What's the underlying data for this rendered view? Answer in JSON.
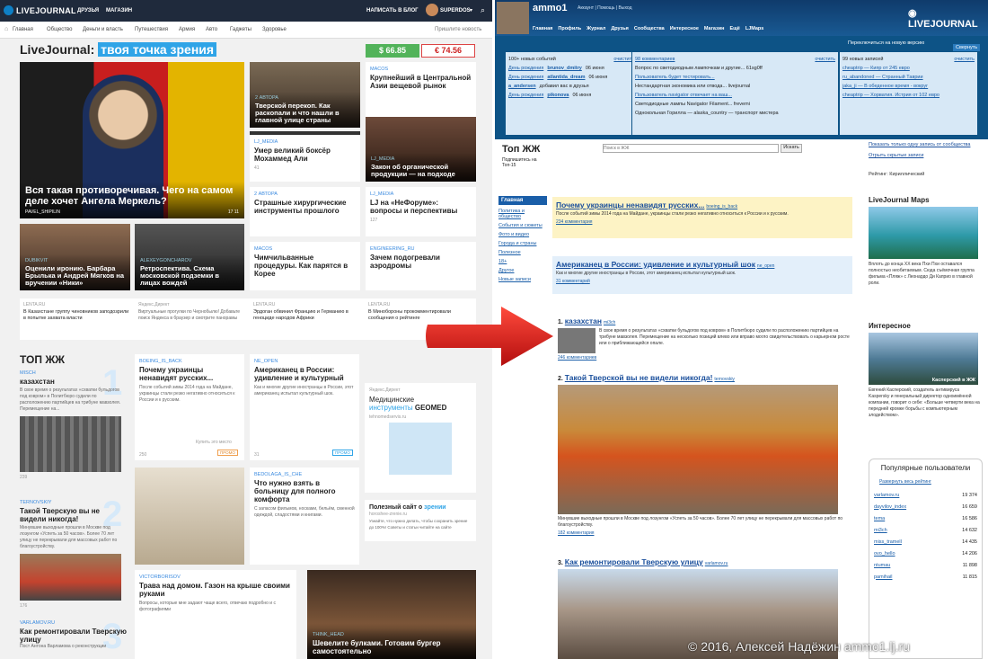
{
  "left": {
    "topbar": {
      "logo": "LIVEJOURNAL",
      "nav": [
        "ДРУЗЬЯ",
        "МАГАЗИН"
      ],
      "write": "НАПИСАТЬ В БЛОГ",
      "user": "SUPERDOS"
    },
    "cats": [
      "Главная",
      "Общество",
      "Деньги и власть",
      "Путешествия",
      "Армия",
      "Авто",
      "Гаджеты",
      "Здоровье"
    ],
    "suggest": "Пришлите новость",
    "headline_a": "LiveJournal:",
    "headline_b": "твоя точка зрения",
    "usd": "$ 66.85",
    "eur": "€ 74.56",
    "hero": {
      "title": "Вся такая противоречивая. Чего на самом деле хочет Ангела Меркель?",
      "author": "PAVEL_SHIPILIN",
      "m1": "17",
      "m2": "11"
    },
    "tiles": [
      {
        "a": "2 АВТОРА",
        "t": "Тверской перекоп. Как раскопали и что нашли в главной улице страны"
      },
      {
        "a": "MACOS",
        "t": "Крупнейший в Центральной Азии вещевой рынок"
      },
      {
        "a": "LJ_MEDIA",
        "t": "Умер великий боксёр Мохаммед Али",
        "m": "41"
      },
      {
        "a": "LJ_MEDIA",
        "t": "Закон об органической продукции — на подходе"
      },
      {
        "a": "2 АВТОРА",
        "t": "Страшные хирургические инструменты прошлого"
      },
      {
        "a": "LJ_MEDIA",
        "t": "LJ на «НеФоруме»: вопросы и перспективы",
        "m": "127"
      },
      {
        "a": "DUBIKVIT",
        "t": "Оценили иронию. Барбара Брылька и Андрей Мягков на вручении «Ники»"
      },
      {
        "a": "ALEXEYGONCHAROV",
        "t": "Ретроспектива. Схема московской подземки в лицах вождей"
      },
      {
        "a": "MACOS",
        "t": "Чимчильванные процедуры. Как парятся в Корее"
      },
      {
        "a": "ENGINEERING_RU",
        "t": "Зачем подогревали аэродромы"
      }
    ],
    "news": [
      {
        "s": "LENTA.RU",
        "t": "В Казахстане группу чиновников заподозрили в попытке захвата власти"
      },
      {
        "s": "Яндекс.Директ",
        "t": "Виртуальные прогулки по Чернобылю! Добавьте поиск Яндекса в браузер и смотрите панорамы"
      },
      {
        "s": "LENTA.RU",
        "t": "Эрдоган обвинил Францию и Германию в геноциде народов Африки"
      },
      {
        "s": "LENTA.RU",
        "t": "В Минобороны прокомментировали сообщения о рейтинге"
      }
    ],
    "top": {
      "title": "ТОП ЖЖ",
      "items": [
        {
          "n": "1",
          "a": "MISCH",
          "t": "казахстан",
          "x": "В свое время о результатах «схватки бульдогов под ковром» в Политбюро судили по расположению партийцев на трибуне мавзолея. Перемещение на...",
          "m": "239"
        },
        {
          "n": "2",
          "a": "TERNOVSKIY",
          "t": "Такой Тверскую вы не видели никогда!",
          "x": "Минувшие выходные прошли в Москве под лозунгом «Успеть за 50 часов». Более 70 лет улицу не перекрывали для массовых работ по благоустройству.",
          "m": "176"
        },
        {
          "n": "3",
          "a": "VARLAMOV.RU",
          "t": "Как ремонтировали Тверскую улицу",
          "x": "Пост Антона Варламова о реконструкции"
        }
      ],
      "c1": {
        "a": "BOEING_IS_BACK",
        "t": "Почему украинцы ненавидят русских...",
        "x": "После событий зимы 2014 года на Майдане, украинцы стали резко негативно относиться к России и к русским.",
        "m": "250",
        "buy": "Купить это место",
        "promo": "ПРОМО"
      },
      "c2": {
        "a": "NE_OPEN",
        "t": "Американец в России: удивление и культурный",
        "x": "Как и многие другие иностранцы в России, этот американец испытал культурный шок.",
        "m": "31",
        "promo": "ПРОМО"
      },
      "c3": {
        "a": "BEDOLAGA_IS_CHE",
        "t": "Что нужно взять в больницу для полного комфорта",
        "x": "С запасом фильмов, носками, бельём, сменной одеждой, сладостями и книгами."
      },
      "c4": {
        "a": "VICTORBORISOV",
        "t": "Трава над домом. Газон на крыше своими руками",
        "x": "Вопросы, которые мне задают чаще всего, отвечаю подробно и с фотографиями"
      },
      "c5": {
        "a": "THINK_HEAD",
        "t": "Шевелите булками. Готовим бургер самостоятельно"
      },
      "ad": {
        "label": "Яндекс.Директ",
        "t1": "Медицинские",
        "t2": "инструменты",
        "t3": "GEOMED",
        "url": "tehnomedservis.ru"
      },
      "ad2": {
        "t": "Полезный сайт о",
        "t2": "зрении",
        "url": "horoshee-zrenie.ru",
        "x": "Узнайте, что нужно делать, чтобы сохранить зрение до 100%! Советы и статьи читайте на сайте"
      }
    }
  },
  "right": {
    "user": "ammo1",
    "links": "Аккаунт | Помощь | Выход",
    "logo": "LIVEJOURNAL",
    "nav": [
      "Главная",
      "Профиль",
      "Журнал",
      "Друзья",
      "Сообщества",
      "Интересное",
      "Магазин",
      "Ещё",
      "LJMaps"
    ],
    "switch": "Переключиться на новую версию",
    "collapse": "Свернуть",
    "col1": {
      "h": "100+ новых событий",
      "clear": "очистить",
      "rows": [
        {
          "t": "День рождения",
          "u": "brunov_dmitry",
          "d": "06 июня"
        },
        {
          "t": "День рождения",
          "u": "atlantida_dream",
          "d": "06 июня"
        },
        {
          "t": "",
          "u": "a_andersen",
          "d": "добавил вас в друзья"
        },
        {
          "t": "День рождения",
          "u": "pikonova",
          "d": "06 июня"
        }
      ]
    },
    "col2": {
      "h": "98 комментариев",
      "clear": "очистить",
      "rows": [
        "Вопрос по светодиодным лампочкам и другие... 61sg0ff",
        "Пользователь будет тестировать...",
        "Нестандартная экономика или отвода... livejournal",
        "Пользователь navigator отвечает на ваш...",
        "Светодиодные лампы Navigator Filament... frevemi",
        "Однокольная Горилла — alaska_country — транспорт мистера"
      ]
    },
    "col3": {
      "h": "99 новых записей",
      "clear": "очистить",
      "rows": [
        "cheaptrip — Кипр от 245 евро",
        "ru_abandoned — Странный Таврии",
        "jaka_ji — В обеденное время - вокруг",
        "cheaptrip — Хорватия. Истрия от 102 евро"
      ]
    },
    "top": {
      "title": "Топ ЖЖ",
      "sub": "Подпишитесь на Топ-15",
      "search_ph": "Поиск в ЖЖ",
      "search_btn": "Искать",
      "side": [
        "Главная",
        "Политика и общество",
        "События и сюжеты",
        "Фото и видео",
        "Города и страны",
        "Полезное",
        "18+",
        "Другое",
        "Новые записи"
      ],
      "promo": [
        {
          "t": "Почему украинцы ненавидят русских...",
          "u": "boeing_is_back",
          "x": "После событий зимы 2014 года на Майдане, украинцы стали резко негативно относиться к России и к русским.",
          "m": "234 комментария"
        },
        {
          "t": "Американец в России: удивление и культурный шок",
          "u": "ne_open",
          "x": "Как и многие другие иностранцы в России, этот американец испытал культурный шок.",
          "m": "31 комментарий"
        }
      ],
      "posts": [
        {
          "n": "1.",
          "t": "казахстан",
          "u": "mi3ch",
          "x": "В свое время о результатах «схватки бульдогов под ковром» в Политбюро судили по расположению партийцев на трибуне мавзолея. Перемещение на несколько позиций влево или вправо могло свидетельствовать о карьерном росте или о приближающейся опале.",
          "m": "246 комментариев"
        },
        {
          "n": "2.",
          "t": "Такой Тверской вы не видели никогда!",
          "u": "ternovskiy",
          "x": "Минувшие выходные прошли в Москве под лозунгом «Успеть за 50 часов». Более 70 лет улицу не перекрывали для массовых работ по благоустройству.",
          "m": "182 комментария"
        },
        {
          "n": "3.",
          "t": "Как ремонтировали Тверскую улицу",
          "u": "varlamov.ru"
        }
      ]
    },
    "side": {
      "links": [
        "Показать только одну запись от сообщества",
        "Отрыть скрытые записи",
        "Рейтинг: Кириллический"
      ],
      "maps_h": "LiveJournal Maps",
      "maps_x": "Вплоть до конца XX века Пхи Пхи оставался полностью необитаемым. Сюда съёмочная группа фильма «Пляж» с Леонардо Ди Каприо в главной роли.",
      "int_h": "Интересное",
      "int_cap": "Касперский в ЖЖ",
      "int_x": "Евгений Касперский, создатель антивируса Kaspersky и генеральный директор одноимённой компании, говорит о себе: «Больше четверти века на передней кромке борьбы с компьютерным злодейством».",
      "pop_h": "Популярные пользователи",
      "pop_sub": "Развернуть весь рейтинг",
      "pop": [
        {
          "u": "varlamov.ru",
          "v": "19 374"
        },
        {
          "u": "dayvilov_index",
          "v": "16 659"
        },
        {
          "u": "tema",
          "v": "16 586"
        },
        {
          "u": "mi3ch",
          "v": "14 632"
        },
        {
          "u": "miss_tramell",
          "v": "14 435"
        },
        {
          "u": "ovo_hello",
          "v": "14 206"
        },
        {
          "u": "ntumau",
          "v": "11 898"
        },
        {
          "u": "pamihail",
          "v": "11 815"
        }
      ]
    }
  },
  "credit": "© 2016, Алексей Надёжин ammo1.lj.ru"
}
